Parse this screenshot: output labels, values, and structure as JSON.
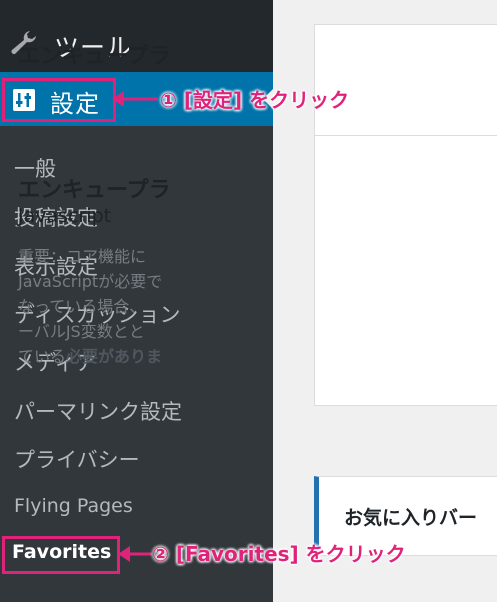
{
  "sidebar": {
    "tools_label": "ツール",
    "settings_label": "設定",
    "items": [
      {
        "label": "一般"
      },
      {
        "label": "投稿設定"
      },
      {
        "label": "表示設定"
      },
      {
        "label": "ディスカッション"
      },
      {
        "label": "メディア"
      },
      {
        "label": "パーマリンク設定"
      },
      {
        "label": "プライバシー"
      },
      {
        "label": "Flying Pages"
      },
      {
        "label": "Favorites"
      }
    ]
  },
  "main": {
    "card1": {
      "title": "エンキュープラ",
      "section_title": "エンキュープラ",
      "section_sub": "Javascript",
      "lines": [
        "重要：コア機能に",
        "JavaScriptが必要で",
        "なっている場合、",
        "ーバルJS変数とと",
        "ている必要がありま"
      ],
      "bold_part": "必要がありま"
    },
    "card2": {
      "title": "お気に入りバー"
    }
  },
  "annotations": {
    "step1": "① [設定] をクリック",
    "step2": "② [Favorites] をクリック"
  },
  "colors": {
    "accent": "#e0237a",
    "active_menu": "#0073aa",
    "sidebar_bg": "#23282d",
    "submenu_bg": "#32373c"
  }
}
